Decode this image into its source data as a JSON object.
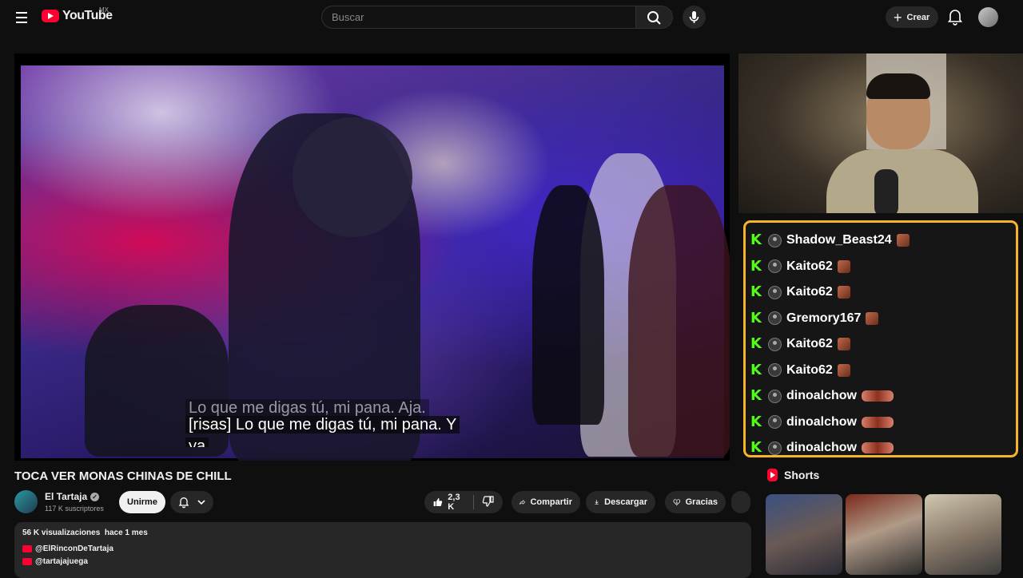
{
  "header": {
    "logo_text": "YouTube",
    "country": "MX",
    "search_placeholder": "Buscar",
    "create_label": "Crear"
  },
  "video": {
    "subtitle_line1": "Lo que me digas tú, mi pana. Aja.",
    "subtitle_line2": "[risas] Lo que me digas tú, mi pana. Y",
    "subtitle_line3": "ya"
  },
  "chat": {
    "messages": [
      {
        "user": "Shadow_Beast24"
      },
      {
        "user": "Kaito62"
      },
      {
        "user": "Kaito62"
      },
      {
        "user": "Gremory167"
      },
      {
        "user": "Kaito62"
      },
      {
        "user": "Kaito62"
      },
      {
        "user": "dinoalchow"
      },
      {
        "user": "dinoalchow"
      },
      {
        "user": "dinoalchow"
      }
    ],
    "border_color": "#f5b52a",
    "kick_color": "#53fc18"
  },
  "details": {
    "title": "TOCA VER MONAS CHINAS DE CHILL",
    "channel_name": "El Tartaja",
    "subscribers": "117 K suscriptores",
    "join_label": "Unirme",
    "likes": "2,3 K",
    "share_label": "Compartir",
    "download_label": "Descargar",
    "thanks_label": "Gracias",
    "views": "56 K visualizaciones",
    "date": "hace 1 mes",
    "links": [
      "@ElRinconDeTartaja",
      "@tartajajuega"
    ]
  },
  "shorts": {
    "heading": "Shorts"
  },
  "colors": {
    "accent": "#ff0033",
    "background": "#0f0f0f"
  }
}
